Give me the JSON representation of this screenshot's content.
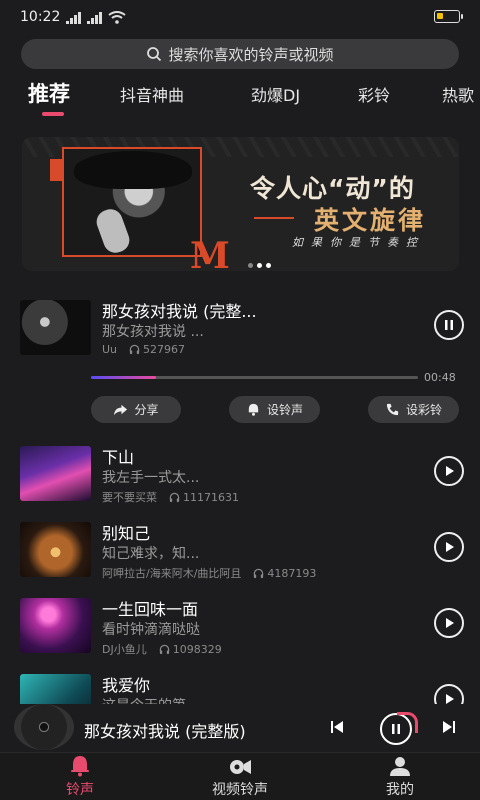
{
  "status": {
    "time": "10:22"
  },
  "search": {
    "placeholder": "搜索你喜欢的铃声或视频"
  },
  "tabs": [
    "推荐",
    "抖音神曲",
    "劲爆DJ",
    "彩铃",
    "热歌"
  ],
  "banner": {
    "title_line1": "令人心“动”的",
    "title_line2": "英文旋律",
    "subtitle": "如果你是节奏控",
    "letter": "M"
  },
  "current_song": {
    "title": "那女孩对我说 (完整...",
    "subtitle": "那女孩对我说 ...",
    "artist": "Uu",
    "plays": "527967",
    "duration": "00:48",
    "progress": 0.2
  },
  "actions": {
    "share": "分享",
    "ringtone": "设铃声",
    "crbt": "设彩铃"
  },
  "songs": [
    {
      "title": "下山",
      "subtitle": "我左手一式太...",
      "artist": "要不要买菜",
      "plays": "11171631"
    },
    {
      "title": "别知己",
      "subtitle": "知己难求，知...",
      "artist": "阿呷拉古/海来阿木/曲比阿且",
      "plays": "4187193"
    },
    {
      "title": "一生回味一面",
      "subtitle": "看时钟滴滴哒哒",
      "artist": "DJ小鱼儿",
      "plays": "1098329"
    },
    {
      "title": "我爱你",
      "subtitle": "这是今天的第..."
    }
  ],
  "mini_player": {
    "title": "那女孩对我说 (完整版)"
  },
  "nav": {
    "ringtone": "铃声",
    "video_ringtone": "视频铃声",
    "mine": "我的"
  },
  "colors": {
    "accent": "#e94b6e",
    "background": "#1c1c1e"
  }
}
